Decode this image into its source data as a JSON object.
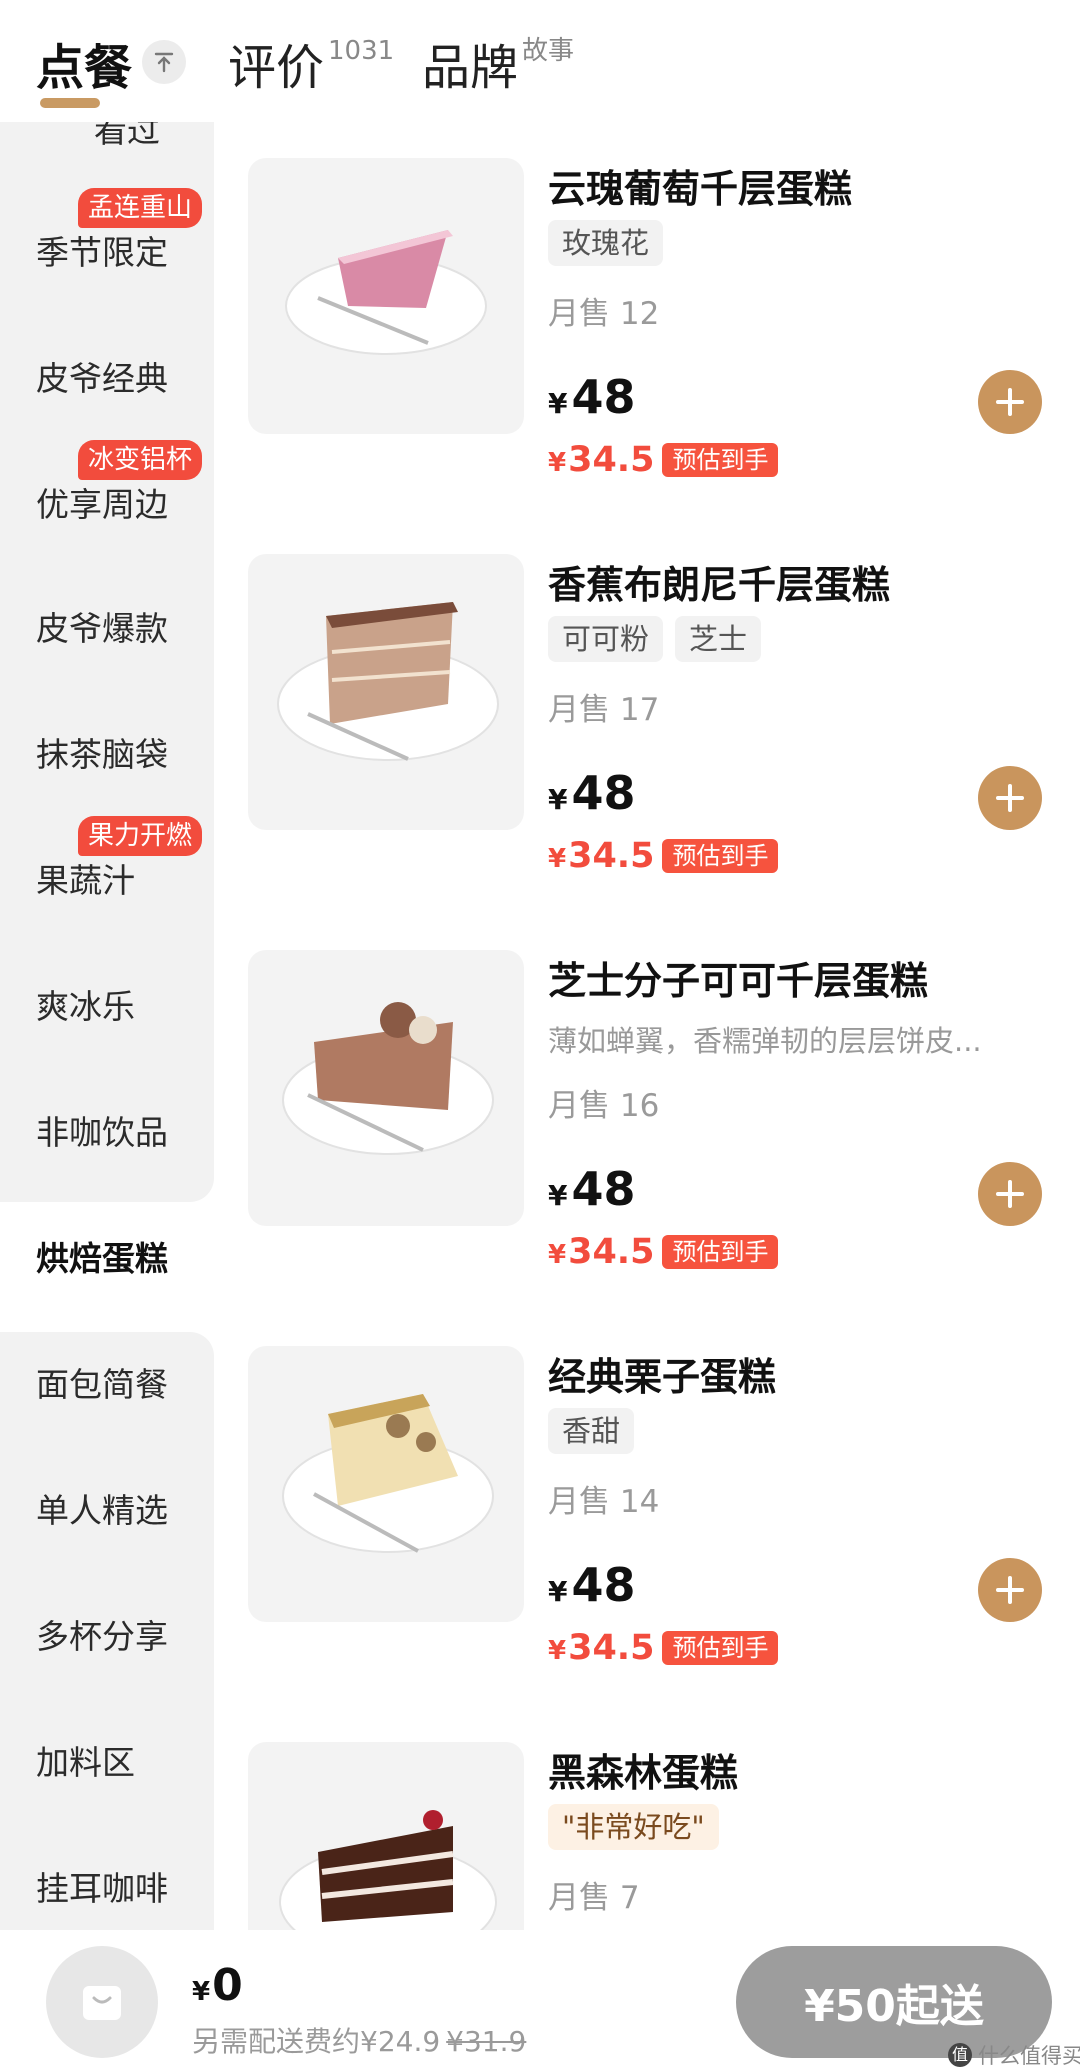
{
  "tabs": [
    {
      "label": "点餐",
      "sup": ""
    },
    {
      "label": "评价",
      "sup": "1031"
    },
    {
      "label": "品牌",
      "sup": "故事"
    }
  ],
  "sidebar": {
    "items": [
      {
        "label": "看过",
        "tag": ""
      },
      {
        "label": "季节限定",
        "tag": "孟连重山"
      },
      {
        "label": "皮爷经典",
        "tag": ""
      },
      {
        "label": "优享周边",
        "tag": "冰变铝杯"
      },
      {
        "label": "皮爷爆款",
        "tag": ""
      },
      {
        "label": "抹茶脑袋",
        "tag": ""
      },
      {
        "label": "果蔬汁",
        "tag": "果力开燃"
      },
      {
        "label": "爽冰乐",
        "tag": ""
      },
      {
        "label": "非咖饮品",
        "tag": ""
      },
      {
        "label": "烘焙蛋糕",
        "tag": ""
      },
      {
        "label": "面包简餐",
        "tag": ""
      },
      {
        "label": "单人精选",
        "tag": ""
      },
      {
        "label": "多杯分享",
        "tag": ""
      },
      {
        "label": "加料区",
        "tag": ""
      },
      {
        "label": "挂耳咖啡",
        "tag": ""
      }
    ]
  },
  "products": [
    {
      "name": "云瑰葡萄千层蛋糕",
      "tags": [
        "玫瑰花"
      ],
      "desc": "",
      "sales": "月售 12",
      "currency": "¥",
      "price": "48",
      "sub_price": "34.5",
      "sub_label": "预估到手"
    },
    {
      "name": "香蕉布朗尼千层蛋糕",
      "tags": [
        "可可粉",
        "芝士"
      ],
      "desc": "",
      "sales": "月售 17",
      "currency": "¥",
      "price": "48",
      "sub_price": "34.5",
      "sub_label": "预估到手"
    },
    {
      "name": "芝士分子可可千层蛋糕",
      "tags": [],
      "desc": "薄如蝉翼，香糯弹韧的层层饼皮...",
      "sales": "月售 16",
      "currency": "¥",
      "price": "48",
      "sub_price": "34.5",
      "sub_label": "预估到手"
    },
    {
      "name": "经典栗子蛋糕",
      "tags": [
        "香甜"
      ],
      "desc": "",
      "sales": "月售 14",
      "currency": "¥",
      "price": "48",
      "sub_price": "34.5",
      "sub_label": "预估到手"
    },
    {
      "name": "黑森林蛋糕",
      "tags": [
        "\"非常好吃\""
      ],
      "desc": "",
      "sales": "月售 7",
      "currency": "",
      "price": "",
      "sub_price": "",
      "sub_label": ""
    }
  ],
  "cart": {
    "currency": "¥",
    "total": "0",
    "delivery_text": "另需配送费约¥24.9",
    "delivery_original": "¥31.9",
    "checkout_label": "¥50起送"
  },
  "watermark": {
    "text": "什么值得买",
    "logo": "值"
  },
  "colors": {
    "accent": "#c9955d",
    "discount": "#f24c3d",
    "sidebar_bg": "#f2f2f2",
    "checkout_bg": "#9d9d9d"
  }
}
